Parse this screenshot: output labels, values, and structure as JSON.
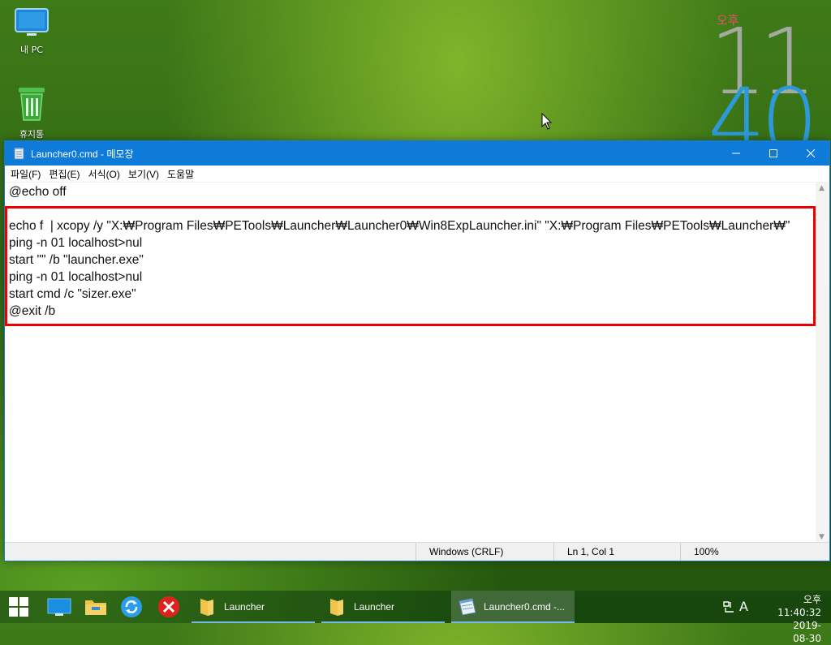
{
  "desktop": {
    "icons": [
      {
        "name": "this-pc",
        "label": "내 PC"
      },
      {
        "name": "recycle-bin",
        "label": "휴지통"
      }
    ],
    "clock_widget": {
      "ampm": "오후",
      "hour": "11",
      "minute": "40"
    }
  },
  "window": {
    "title": "Launcher0.cmd - 메모장",
    "menu": [
      "파일(F)",
      "편집(E)",
      "서식(O)",
      "보기(V)",
      "도움말"
    ],
    "lines": [
      "@echo off",
      "",
      "echo f  | xcopy /y \"X:₩Program Files₩PETools₩Launcher₩Launcher0₩Win8ExpLauncher.ini\" \"X:₩Program Files₩PETools₩Launcher₩\"",
      "ping -n 01 localhost>nul",
      "start \"\" /b \"launcher.exe\"",
      "ping -n 01 localhost>nul",
      "start cmd /c \"sizer.exe\"",
      "@exit /b"
    ],
    "status": {
      "encoding": "Windows (CRLF)",
      "position": "Ln 1, Col 1",
      "zoom": "100%"
    }
  },
  "taskbar": {
    "tasks": [
      {
        "label": "Launcher"
      },
      {
        "label": "Launcher"
      },
      {
        "label": "Launcher0.cmd -..."
      }
    ],
    "tray": {
      "ime_lang": "A",
      "time": "오후 11:40:32",
      "date": "2019-08-30"
    }
  },
  "colors": {
    "titlebar": "#0f7bd9",
    "highlight": "#e00000",
    "clock_gray": "#a8a8a8",
    "clock_blue": "#2c9ad9"
  }
}
